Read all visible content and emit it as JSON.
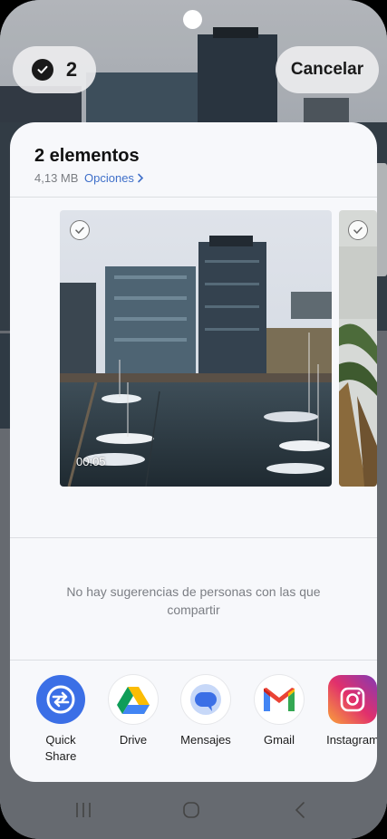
{
  "selection": {
    "count": "2"
  },
  "cancel_label": "Cancelar",
  "sheet": {
    "title": "2 elementos",
    "size": "4,13 MB",
    "options_label": "Opciones",
    "video_duration": "00:05",
    "no_suggestions": "No hay sugerencias de personas con las que compartir"
  },
  "apps": [
    {
      "label": "Quick\nShare",
      "icon": "quick-share-icon"
    },
    {
      "label": "Drive",
      "icon": "drive-icon"
    },
    {
      "label": "Mensajes",
      "icon": "messages-icon"
    },
    {
      "label": "Gmail",
      "icon": "gmail-icon"
    },
    {
      "label": "Instagram",
      "icon": "instagram-icon"
    }
  ],
  "colors": {
    "accent": "#3f6fc9",
    "sheet_bg": "#f7f8fb"
  }
}
